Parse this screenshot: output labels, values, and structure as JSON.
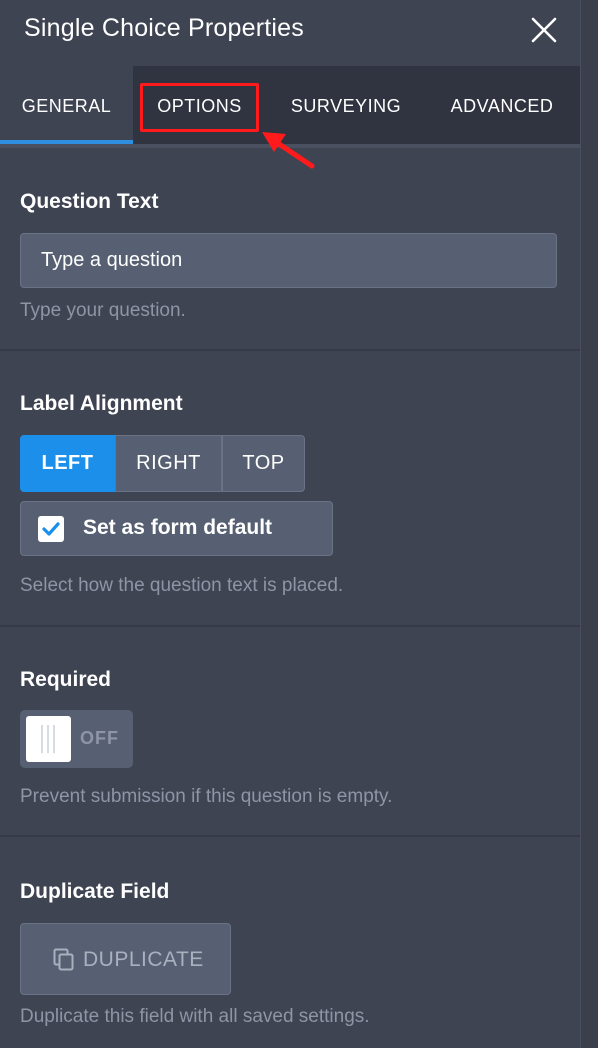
{
  "header": {
    "title": "Single Choice Properties",
    "close_icon": "close-icon"
  },
  "tabs": [
    {
      "label": "GENERAL",
      "active": true
    },
    {
      "label": "OPTIONS",
      "active": false,
      "highlighted": true
    },
    {
      "label": "SURVEYING",
      "active": false
    },
    {
      "label": "ADVANCED",
      "active": false
    }
  ],
  "question_text": {
    "title": "Question Text",
    "value": "Type a question",
    "hint": "Type your question."
  },
  "label_alignment": {
    "title": "Label Alignment",
    "options": [
      "LEFT",
      "RIGHT",
      "TOP"
    ],
    "selected": "LEFT",
    "checkbox_label": "Set as form default",
    "checkbox_checked": true,
    "hint": "Select how the question text is placed."
  },
  "required": {
    "title": "Required",
    "toggle_label": "OFF",
    "hint": "Prevent submission if this question is empty."
  },
  "duplicate_field": {
    "title": "Duplicate Field",
    "button_label": "DUPLICATE",
    "hint": "Duplicate this field with all saved settings."
  },
  "colors": {
    "accent": "#1b8fea",
    "panel_bg": "#3e4452",
    "tab_bar_bg": "#2f3440",
    "highlight": "#ff1b1b"
  }
}
